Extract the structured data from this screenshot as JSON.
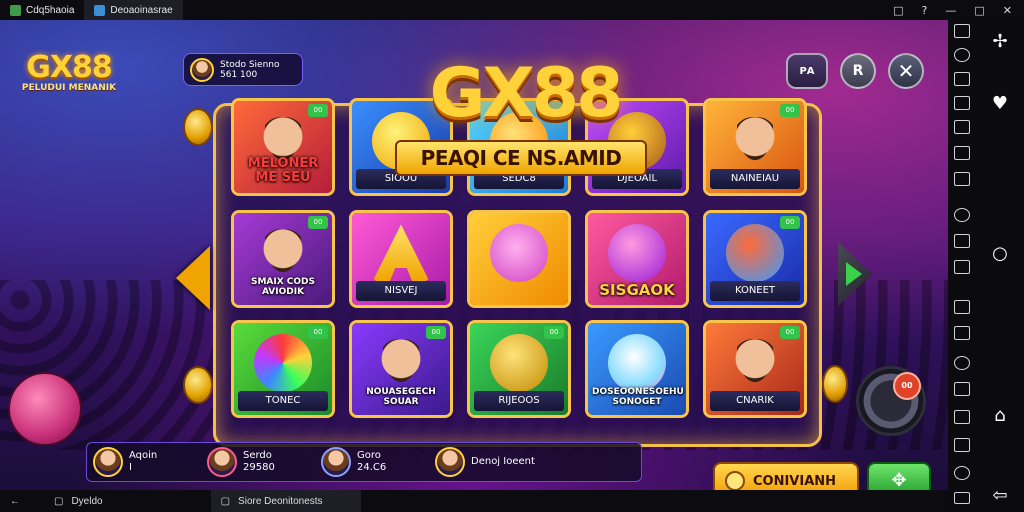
{
  "window": {
    "tabs": [
      {
        "label": "Cdq5haoia",
        "color": "#3f9b4a"
      },
      {
        "label": "Deoaoinasrae",
        "color": "#3a8fd6"
      }
    ],
    "controls": [
      "□",
      "?",
      "—",
      "□",
      "✕"
    ]
  },
  "game": {
    "logo_text": "GX88",
    "logo_sub": "PELUDUI MENANIK",
    "player": {
      "name": "Stodo Sienno",
      "score": "561 100"
    },
    "title": "GX88",
    "subtitle": "PEAQI CE NS.AMID",
    "top_buttons": {
      "settings": "РА",
      "profile": "R",
      "close": "✕"
    },
    "tiles": [
      {
        "badge": "00",
        "label": "MELONER ME SEU",
        "label_type": "mid"
      },
      {
        "badge": "",
        "label": "SIOOU",
        "label_type": "bar"
      },
      {
        "badge": "",
        "label": "SEDC8",
        "label_type": "bar"
      },
      {
        "badge": "",
        "label": "DJEOAIL",
        "label_type": "bar"
      },
      {
        "badge": "00",
        "label": "NAINEIAU",
        "label_type": "bar"
      },
      {
        "badge": "00",
        "label": "SMAIX CODS AVIODIK",
        "label_type": "mid"
      },
      {
        "badge": "",
        "label": "NISVEJ",
        "label_type": "bar"
      },
      {
        "badge": "",
        "label": "",
        "label_type": "none"
      },
      {
        "badge": "",
        "label": "SISGAOK",
        "label_type": "mid"
      },
      {
        "badge": "00",
        "label": "KONEET",
        "label_type": "bar"
      },
      {
        "badge": "00",
        "label": "TONEC",
        "label_type": "bar"
      },
      {
        "badge": "00",
        "label": "NOUASEGECH SOUAR",
        "label_type": "mid"
      },
      {
        "badge": "00",
        "label": "RIJEOOS",
        "label_type": "bar"
      },
      {
        "badge": "",
        "label": "DOSEOONESOEHU SONOGET",
        "label_type": "mid"
      },
      {
        "badge": "00",
        "label": "CNARIK",
        "label_type": "bar"
      }
    ],
    "players_strip": [
      {
        "name": "Aqoin",
        "score": "I"
      },
      {
        "name": "Serdo",
        "score": "29580"
      },
      {
        "name": "Goro",
        "score": "24.C6"
      },
      {
        "name": "Denoj Ioeent",
        "score": ""
      }
    ],
    "continue_label": "CONIVIANH",
    "gift_icon": "✥",
    "spin_badge": "00"
  },
  "android_nav": {
    "bottom_tabs": [
      {
        "icon": "←",
        "label": ""
      },
      {
        "icon": "▢",
        "label": "Dyeldo"
      },
      {
        "icon": "▢",
        "label": "Siore Deonitonests"
      }
    ]
  }
}
